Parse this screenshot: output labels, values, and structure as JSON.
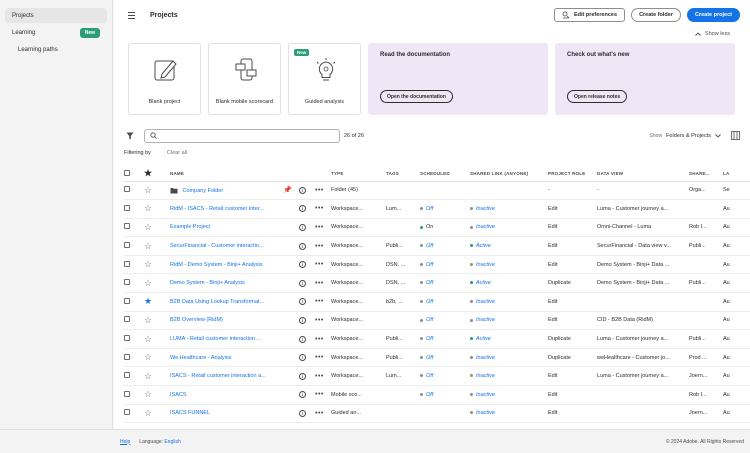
{
  "sidebar": {
    "items": [
      {
        "label": "Projects",
        "active": true
      },
      {
        "label": "Learning",
        "badge": "New"
      },
      {
        "label": "Learning paths",
        "sub": true
      }
    ]
  },
  "header": {
    "title": "Projects",
    "edit_prefs": "Edit preferences",
    "create_folder": "Create folder",
    "create_project": "Create project",
    "show_less": "Show less"
  },
  "cards": [
    {
      "label": "Blank project"
    },
    {
      "label": "Blank mobile scorecard"
    },
    {
      "label": "Guided analysis",
      "badge": "New"
    }
  ],
  "doc_cards": [
    {
      "title": "Read the documentation",
      "button": "Open the documentation"
    },
    {
      "title": "Check out what's new",
      "button": "Open release notes"
    }
  ],
  "toolbar": {
    "search_placeholder": "",
    "count": "26 of 26",
    "show_label": "Show",
    "show_value": "Folders & Projects",
    "filtering_label": "Filtering by",
    "clear_all": "Clear all"
  },
  "table": {
    "columns": [
      "NAME",
      "TYPE",
      "TAGS",
      "SCHEDULED",
      "SHARED LINK (ANYONE)",
      "PROJECT ROLE",
      "DATA VIEW",
      "SHARE...",
      "LA"
    ],
    "rows": [
      {
        "name": "Company Folder",
        "folder": true,
        "pinned": true,
        "star": false,
        "type": "Folder (45)",
        "tags": "",
        "scheduled": "",
        "shared": "",
        "role": "-",
        "dataview": "-",
        "share": "Orga...",
        "last": "Se"
      },
      {
        "name": "RidM - ISACS - Retail customer inter...",
        "star": false,
        "type": "Workspace...",
        "tags": "Lum...",
        "scheduled": "Off",
        "shared": "Inactive",
        "role": "Edit",
        "dataview": "Luma - Customer journey a...",
        "share": "",
        "last": "Au"
      },
      {
        "name": "Example Project",
        "star": false,
        "type": "Workspace...",
        "tags": "",
        "scheduled": "On",
        "shared": "Inactive",
        "role": "Edit",
        "dataview": "Omni-Channel - Luma",
        "share": "Rob I...",
        "last": "Au"
      },
      {
        "name": "SecurFinancial - Customer interactio...",
        "star": false,
        "type": "Workspace...",
        "tags": "Publi...",
        "scheduled": "Off",
        "shared": "Active",
        "role": "Edit",
        "dataview": "SecurFinancial - Data view v...",
        "share": "Publi...",
        "last": "Au"
      },
      {
        "name": "RidM - Demo System - Binji+ Analysis",
        "star": false,
        "type": "Workspace...",
        "tags": "DSN, ...",
        "scheduled": "Off",
        "shared": "Inactive",
        "role": "Edit",
        "dataview": "Demo System - Binji+ Data ...",
        "share": "",
        "last": "Au"
      },
      {
        "name": "Demo System - Binji+ Analysis",
        "star": false,
        "type": "Workspace...",
        "tags": "DSN, ...",
        "scheduled": "Off",
        "shared": "Active",
        "role": "Duplicate",
        "dataview": "Demo System - Binji+ Data ...",
        "share": "Publi...",
        "last": "Au"
      },
      {
        "name": "B2B Data Using Lookup Transformat...",
        "star": true,
        "type": "Workspace...",
        "tags": "b2b, ...",
        "scheduled": "Off",
        "shared": "Inactive",
        "role": "Edit",
        "dataview": "",
        "share": "",
        "last": "Au"
      },
      {
        "name": "B2B Overview (RidM)",
        "star": false,
        "type": "Workspace...",
        "tags": "",
        "scheduled": "Off",
        "shared": "Inactive",
        "role": "Edit",
        "dataview": "CID - B2B Data (RidM)",
        "share": "",
        "last": "Au"
      },
      {
        "name": "LUMA - Retail customer interaction ...",
        "star": false,
        "type": "Workspace...",
        "tags": "Publi...",
        "scheduled": "Off",
        "shared": "Active",
        "role": "Duplicate",
        "dataview": "Luma - Customer journey a...",
        "share": "Publi...",
        "last": "Au"
      },
      {
        "name": "We.Healthcare - Analysis",
        "star": false,
        "type": "Workspace...",
        "tags": "Publi...",
        "scheduled": "Off",
        "shared": "Inactive",
        "role": "Duplicate",
        "dataview": "weHealthcare - Customer jo...",
        "share": "Prod ...",
        "last": "Au"
      },
      {
        "name": "ISACS - Retail customer interaction a...",
        "star": false,
        "type": "Workspace...",
        "tags": "Lum...",
        "scheduled": "Off",
        "shared": "Inactive",
        "role": "Edit",
        "dataview": "Luma - Customer journey a...",
        "share": "Joern...",
        "last": "Au"
      },
      {
        "name": "ISACS",
        "star": false,
        "type": "Mobile sco...",
        "tags": "",
        "scheduled": "Off",
        "shared": "Inactive",
        "role": "Edit",
        "dataview": "",
        "share": "Rob I...",
        "last": "Au"
      },
      {
        "name": "ISACS FUNNEL",
        "star": false,
        "type": "Guided an...",
        "tags": "",
        "scheduled": "",
        "shared": "Inactive",
        "role": "Edit",
        "dataview": "",
        "share": "Joern...",
        "last": "Au"
      }
    ]
  },
  "footer": {
    "help": "Help",
    "language_label": "Language:",
    "language": "English",
    "copyright": "© 2024 Adobe. All Rights Reserved"
  },
  "colors": {
    "accent": "#1473e6",
    "green": "#2d9d78",
    "doc_bg": "#efe7f6"
  }
}
